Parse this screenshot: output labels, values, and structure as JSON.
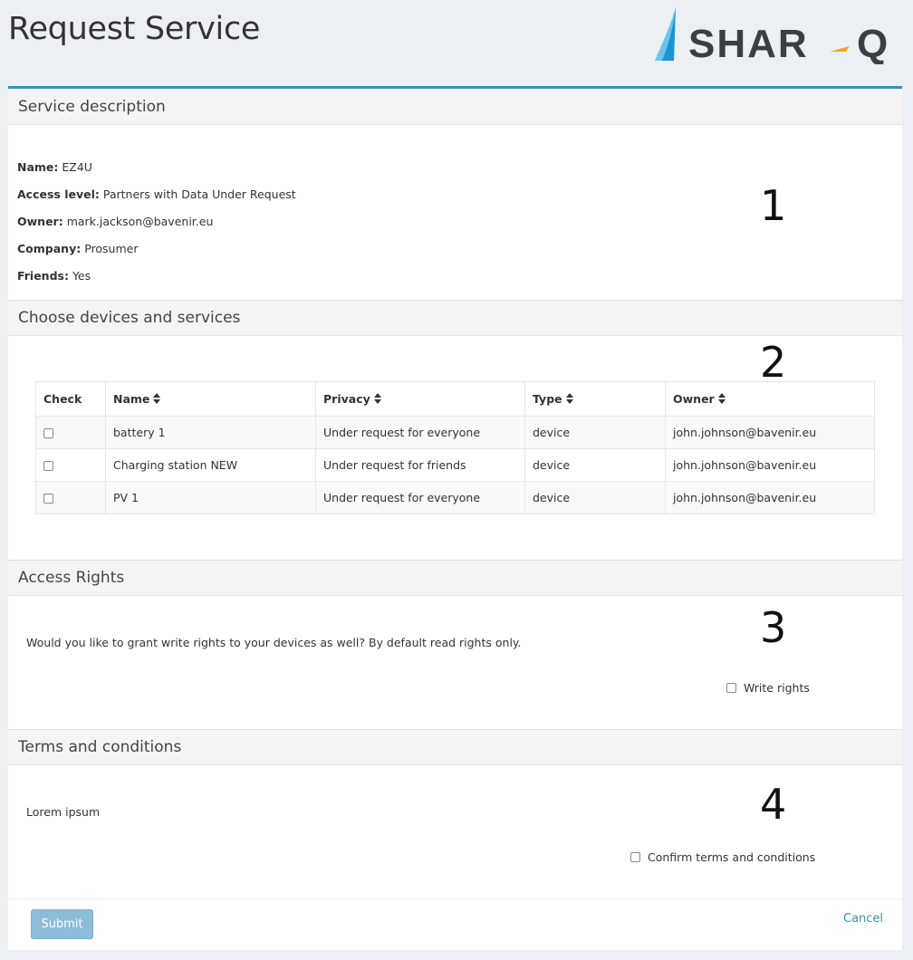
{
  "page": {
    "title": "Request Service"
  },
  "logo": {
    "text": "SHAR-Q",
    "name": "shar-q-logo"
  },
  "colors": {
    "accent": "#3c8dbc",
    "submit_bg": "#8bbcd8",
    "logo_blue": "#1b95d1",
    "logo_orange": "#f5a623",
    "logo_gray": "#3a3f44"
  },
  "service_description": {
    "title": "Service description",
    "step": "1",
    "fields": [
      {
        "label": "Name:",
        "value": "EZ4U"
      },
      {
        "label": "Access level:",
        "value": "Partners with Data Under Request"
      },
      {
        "label": "Owner:",
        "value": "mark.jackson@bavenir.eu"
      },
      {
        "label": "Company:",
        "value": "Prosumer"
      },
      {
        "label": "Friends:",
        "value": "Yes"
      }
    ]
  },
  "devices": {
    "title": "Choose devices and services",
    "step": "2",
    "columns": [
      "Check",
      "Name",
      "Privacy",
      "Type",
      "Owner"
    ],
    "sortable": [
      false,
      true,
      true,
      true,
      true
    ],
    "rows": [
      {
        "name": "battery 1",
        "privacy": "Under request for everyone",
        "type": "device",
        "owner": "john.johnson@bavenir.eu",
        "checked": false
      },
      {
        "name": "Charging station NEW",
        "privacy": "Under request for friends",
        "type": "device",
        "owner": "john.johnson@bavenir.eu",
        "checked": false
      },
      {
        "name": "PV 1",
        "privacy": "Under request for everyone",
        "type": "device",
        "owner": "john.johnson@bavenir.eu",
        "checked": false
      }
    ]
  },
  "access_rights": {
    "title": "Access Rights",
    "step": "3",
    "question": "Would you like to grant write rights to your devices as well? By default read rights only.",
    "checkbox_label": "Write rights",
    "checked": false
  },
  "terms": {
    "title": "Terms and conditions",
    "step": "4",
    "text": "Lorem ipsum",
    "checkbox_label": "Confirm terms and conditions",
    "checked": false
  },
  "footer": {
    "submit_label": "Submit",
    "cancel_label": "Cancel"
  }
}
